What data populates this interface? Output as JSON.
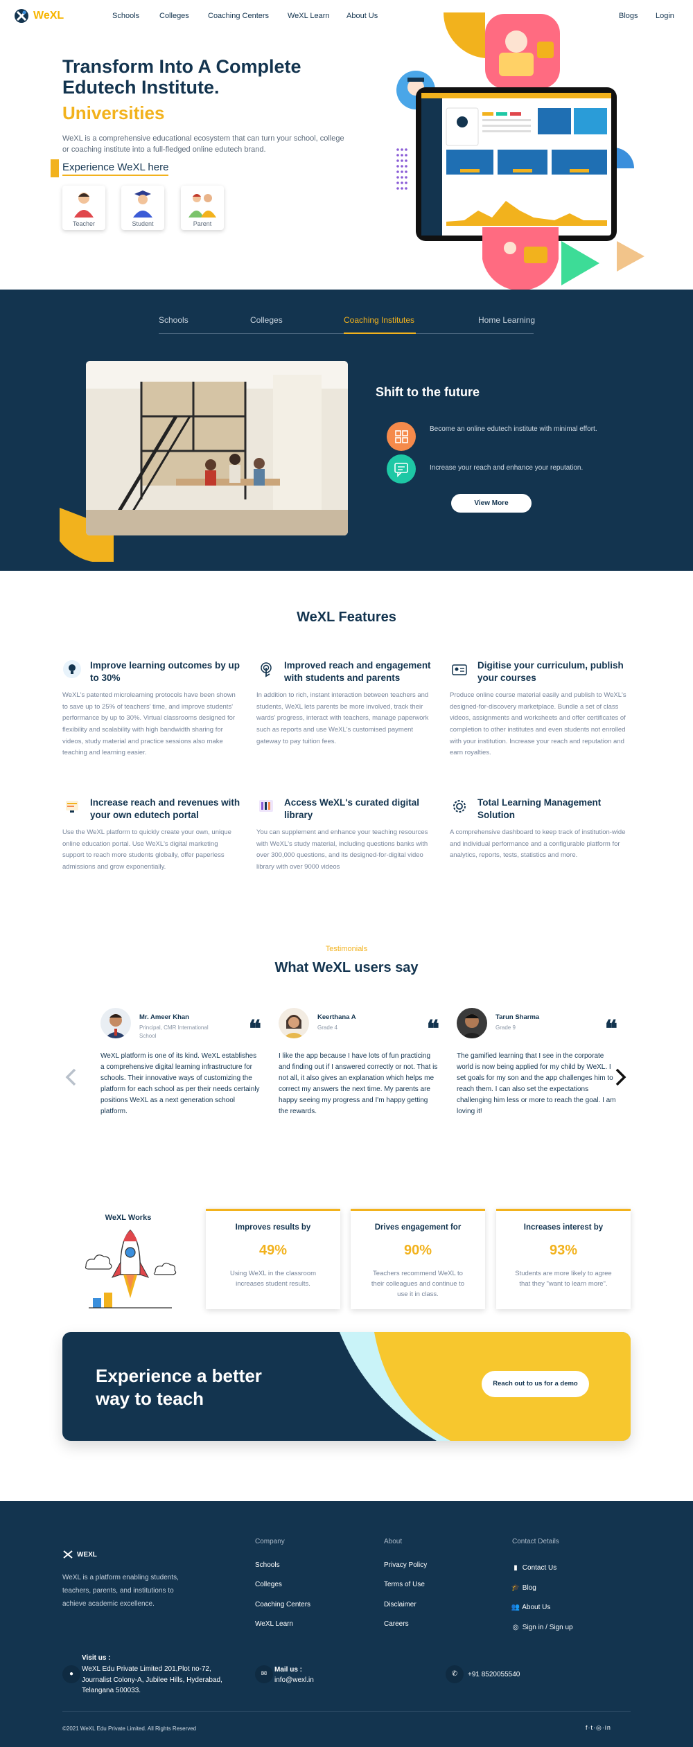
{
  "nav": {
    "logo": "WeXL",
    "links": [
      "Schools",
      "Colleges",
      "Coaching Centers",
      "WeXL Learn",
      "About Us"
    ],
    "blogs": "Blogs",
    "login": "Login"
  },
  "hero": {
    "title": "Transform Into A Complete Edutech Institute.",
    "subtitle": "Universities",
    "description": "WeXL is a comprehensive educational ecosystem that can turn your school, college or coaching institute into a full-fledged online edutech brand.",
    "cta": "Experience WeXL here",
    "roles": [
      "Teacher",
      "Student",
      "Parent"
    ]
  },
  "tabs": [
    "Schools",
    "Colleges",
    "Coaching Institutes",
    "Home Learning"
  ],
  "shift": {
    "title": "Shift to the future",
    "items": [
      "Become an online edutech institute with minimal effort.",
      "Increase your reach and enhance your reputation."
    ],
    "button": "View More"
  },
  "features": {
    "title": "WeXL Features",
    "items": [
      {
        "title": "Improve learning outcomes by up to 30%",
        "text": "WeXL's patented microlearning protocols have been shown to save up to 25% of teachers' time, and improve students' performance by up to 30%. Virtual classrooms designed for flexibility and scalability with high bandwidth sharing for videos, study material and practice sessions also make teaching and learning easier.",
        "icon": "lightbulb-icon"
      },
      {
        "title": "Improved reach and engagement with students and parents",
        "text": "In addition to rich, instant interaction between teachers and students, WeXL lets parents be more involved, track their wards' progress, interact with teachers, manage paperwork such as reports and use WeXL's customised payment gateway to pay tuition fees.",
        "icon": "touch-icon"
      },
      {
        "title": "Digitise your curriculum, publish your courses",
        "text": "Produce online course material easily and publish to WeXL's designed-for-discovery marketplace. Bundle a set of class videos, assignments and worksheets and offer certificates of completion to other institutes and even students not enrolled with your institution. Increase your reach and reputation and earn royalties.",
        "icon": "id-card-icon"
      },
      {
        "title": "Increase reach and revenues with your own edutech portal",
        "text": "Use the WeXL platform to quickly create your own, unique online education portal. Use WeXL's digital marketing support to reach more students globally, offer paperless admissions and grow exponentially.",
        "icon": "portal-icon"
      },
      {
        "title": "Access WeXL's curated digital library",
        "text": "You can supplement and enhance your teaching resources with WeXL's study material, including questions banks with over 300,000 questions, and its designed-for-digital video library with over 9000 videos",
        "icon": "library-icon"
      },
      {
        "title": "Total Learning Management Solution",
        "text": "A comprehensive dashboard to keep track of institution-wide and individual performance and a configurable platform for analytics, reports, tests, statistics and more.",
        "icon": "gear-icon"
      }
    ]
  },
  "testimonials": {
    "label": "Testimonials",
    "title": "What WeXL users say",
    "items": [
      {
        "name": "Mr. Ameer Khan",
        "role": "Principal, CMR International School",
        "text": "WeXL platform is one of its kind. WeXL establishes a comprehensive digital learning infrastructure for schools. Their innovative ways of customizing the platform for each school as per their needs certainly positions WeXL as a next generation school platform."
      },
      {
        "name": "Keerthana A",
        "role": "Grade 4",
        "text": "I like the app because I have lots of fun practicing and finding out if I answered correctly or not. That is not all, it also gives an explanation which helps me correct my answers the next time. My parents are happy seeing my progress and I'm happy getting the rewards."
      },
      {
        "name": "Tarun Sharma",
        "role": "Grade 9",
        "text": "The gamified learning that I see in the corporate world is now being applied for my child by WeXL. I set goals for my son and the app challenges him to reach them. I can also set the expectations challenging him less or more to reach the goal. I am loving it!"
      }
    ]
  },
  "works": {
    "title": "WeXL Works",
    "stats": [
      {
        "title": "Improves results by",
        "value": "49%",
        "text": "Using WeXL in the classroom increases student results."
      },
      {
        "title": "Drives engagement for",
        "value": "90%",
        "text": "Teachers recommend WeXL to their colleagues and continue to use it in class."
      },
      {
        "title": "Increases interest by",
        "value": "93%",
        "text": "Students are more likely to agree that they \"want to learn more\"."
      }
    ]
  },
  "cta": {
    "title": "Experience a better way to teach",
    "button": "Reach out to us for a demo"
  },
  "footer": {
    "logo": "WEXL",
    "about": "WeXL is a platform enabling students, teachers, parents, and institutions to achieve academic excellence.",
    "company_head": "Company",
    "company": [
      "Schools",
      "Colleges",
      "Coaching Centers",
      "WeXL Learn"
    ],
    "about_head": "About",
    "about_links": [
      "Privacy Policy",
      "Terms of Use",
      "Disclaimer",
      "Careers"
    ],
    "contact_head": "Contact Details",
    "contact": [
      "Contact Us",
      "Blog",
      "About Us",
      "Sign in / Sign up"
    ],
    "visit_label": "Visit us :",
    "address": "WeXL Edu Private Limited 201,Plot no-72, Journalist Colony-A, Jubilee Hills, Hyderabad, Telangana 500033.",
    "mail_label": "Mail us :",
    "email": "info@wexl.in",
    "phone": "+91 8520055540",
    "copyright": "©2021 WeXL Edu Private Limited. All Rights Reserved"
  },
  "colors": {
    "navy": "#13344f",
    "yellow": "#f2b21d",
    "orange": "#f58a4b",
    "teal": "#1ec8a5",
    "pink": "#ff6b81",
    "blue": "#3b8fdc"
  }
}
